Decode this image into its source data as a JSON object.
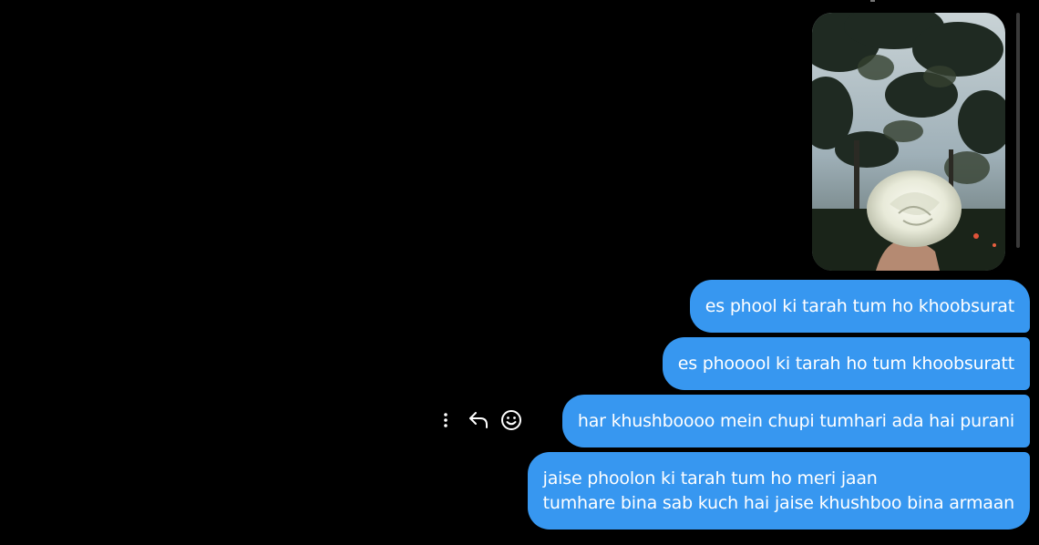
{
  "thread": {
    "photo": {
      "alt": "white rose held in hand against trees and evening sky"
    },
    "messages": [
      {
        "lines": [
          "es phool ki tarah tum ho khoobsurat"
        ]
      },
      {
        "lines": [
          "es phooool ki tarah ho tum khoobsuratt"
        ]
      },
      {
        "lines": [
          "har khushboooo mein chupi tumhari ada hai purani"
        ]
      },
      {
        "lines": [
          "jaise phoolon ki tarah tum ho meri jaan",
          "tumhare bina sab kuch hai jaise khushboo bina armaan"
        ]
      }
    ],
    "hover_actions": {
      "more": "more-options-icon",
      "reply": "reply-icon",
      "react": "emoji-react-icon"
    }
  },
  "colors": {
    "background": "#000000",
    "bubble": "#3797f0",
    "text": "#ffffff",
    "icon": "#ffffff"
  }
}
